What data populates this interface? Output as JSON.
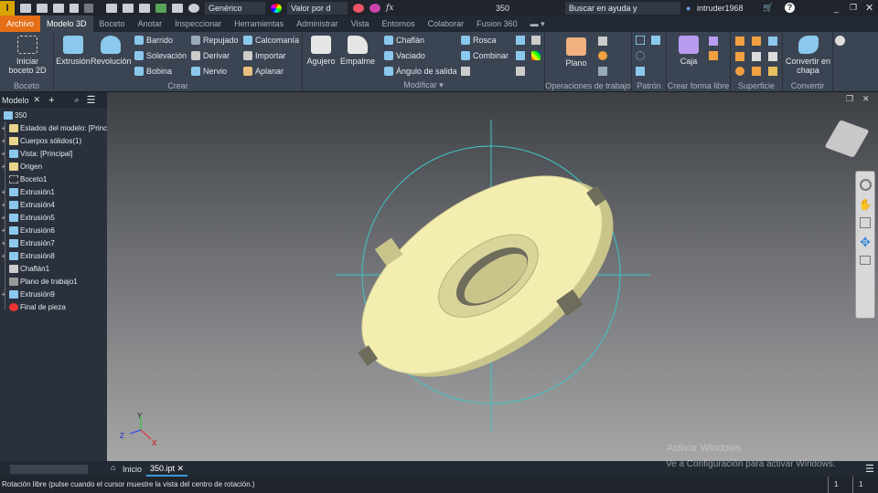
{
  "titlebar": {
    "app_logo": "I",
    "appearance": "Genérico",
    "material": "Valor por d",
    "doc_title": "350",
    "search_placeholder": "Buscar en ayuda y comandos...",
    "user": "intruder1968",
    "fx": "fx"
  },
  "tabs": [
    "Archivo",
    "Modelo 3D",
    "Boceto",
    "Anotar",
    "Inspeccionar",
    "Herramientas",
    "Administrar",
    "Vista",
    "Entornos",
    "Colaborar",
    "Fusion 360"
  ],
  "ribbon": {
    "boceto": {
      "label": "Boceto",
      "start": "Iniciar boceto 2D"
    },
    "crear": {
      "label": "Crear",
      "extrusion": "Extrusión",
      "revolucion": "Revolución",
      "col1": [
        "Barrido",
        "Solevación",
        "Bobina"
      ],
      "col2": [
        "Repujado",
        "Derivar",
        "Nervio"
      ],
      "col3": [
        "Calcomanía",
        "Importar",
        "Aplanar"
      ]
    },
    "modificar": {
      "label": "Modificar",
      "agujero": "Agujero",
      "empalme": "Empalme",
      "col1": [
        "Chaflán",
        "Vaciado",
        "Ángulo de salida"
      ],
      "col2": [
        "Rosca",
        "Combinar"
      ]
    },
    "operaciones": {
      "label": "Operaciones de trabajo",
      "plano": "Plano"
    },
    "patron": {
      "label": "Patrón"
    },
    "forma_libre": {
      "label": "Crear forma libre",
      "caja": "Caja"
    },
    "superficie": {
      "label": "Superficie"
    },
    "convertir": {
      "label": "Convertir",
      "chapa": "Convertir en chapa"
    }
  },
  "browser": {
    "tab": "Modelo",
    "root": "350",
    "items": [
      {
        "label": "Estados del modelo: [Principal]",
        "expand": true,
        "icon": "folder"
      },
      {
        "label": "Cuerpos sólidos(1)",
        "expand": true,
        "icon": "folder"
      },
      {
        "label": "Vista: [Principal]",
        "expand": true,
        "icon": "view"
      },
      {
        "label": "Origen",
        "expand": true,
        "icon": "folder"
      },
      {
        "label": "Boceto1",
        "expand": false,
        "icon": "sketch"
      },
      {
        "label": "Extrusión1",
        "expand": true,
        "icon": "extrude"
      },
      {
        "label": "Extrusión4",
        "expand": true,
        "icon": "extrude"
      },
      {
        "label": "Extrusión5",
        "expand": true,
        "icon": "extrude"
      },
      {
        "label": "Extrusión6",
        "expand": true,
        "icon": "extrude"
      },
      {
        "label": "Extrusión7",
        "expand": true,
        "icon": "extrude"
      },
      {
        "label": "Extrusión8",
        "expand": true,
        "icon": "extrude"
      },
      {
        "label": "Chaflán1",
        "expand": false,
        "icon": "chamfer"
      },
      {
        "label": "Plano de trabajo1",
        "expand": false,
        "icon": "plane"
      },
      {
        "label": "Extrusión9",
        "expand": true,
        "icon": "extrude"
      },
      {
        "label": "Final de pieza",
        "expand": false,
        "icon": "end"
      }
    ]
  },
  "doctabs": {
    "home": "Inicio",
    "doc": "350.ipt"
  },
  "watermark": {
    "title": "Activar Windows",
    "sub": "Ve a Configuración para activar Windows."
  },
  "status": {
    "text": "Rotación libre (pulse cuando el cursor muestre la vista del centro de rotación.)",
    "count1": "1",
    "count2": "1"
  },
  "axes": {
    "x": "X",
    "y": "Y",
    "z": "Z"
  },
  "colors": {
    "part": "#f3eeb0",
    "file_tab": "#e46f17",
    "circle": "#3fc6c6"
  }
}
